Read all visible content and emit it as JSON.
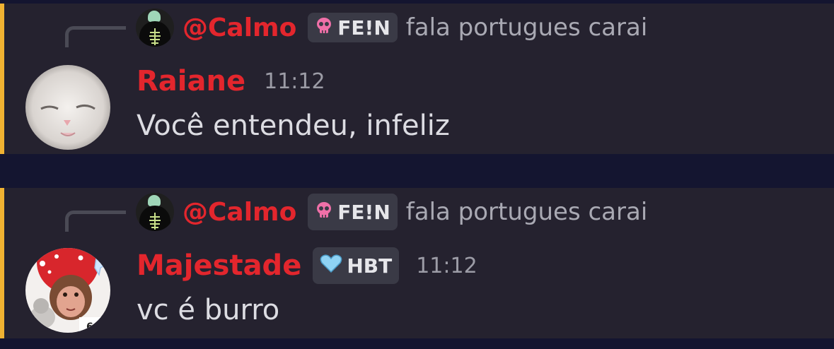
{
  "colors": {
    "username": "#e3262d",
    "mention_bar": "#f0b232",
    "message_bg": "#25222f",
    "gap_bg": "#141530"
  },
  "messages": [
    {
      "reply": {
        "username": "@Calmo",
        "tag_icon": "skull-icon",
        "tag_label": "FE!N",
        "text": "fala portugues carai"
      },
      "author": "Raiane",
      "author_tag": null,
      "time": "11:12",
      "content": "Você entendeu, infeliz"
    },
    {
      "reply": {
        "username": "@Calmo",
        "tag_icon": "skull-icon",
        "tag_label": "FE!N",
        "text": "fala portugues carai"
      },
      "author": "Majestade",
      "author_tag": {
        "icon": "heart-icon",
        "label": "HBT"
      },
      "time": "11:12",
      "content": "vc é burro"
    }
  ]
}
